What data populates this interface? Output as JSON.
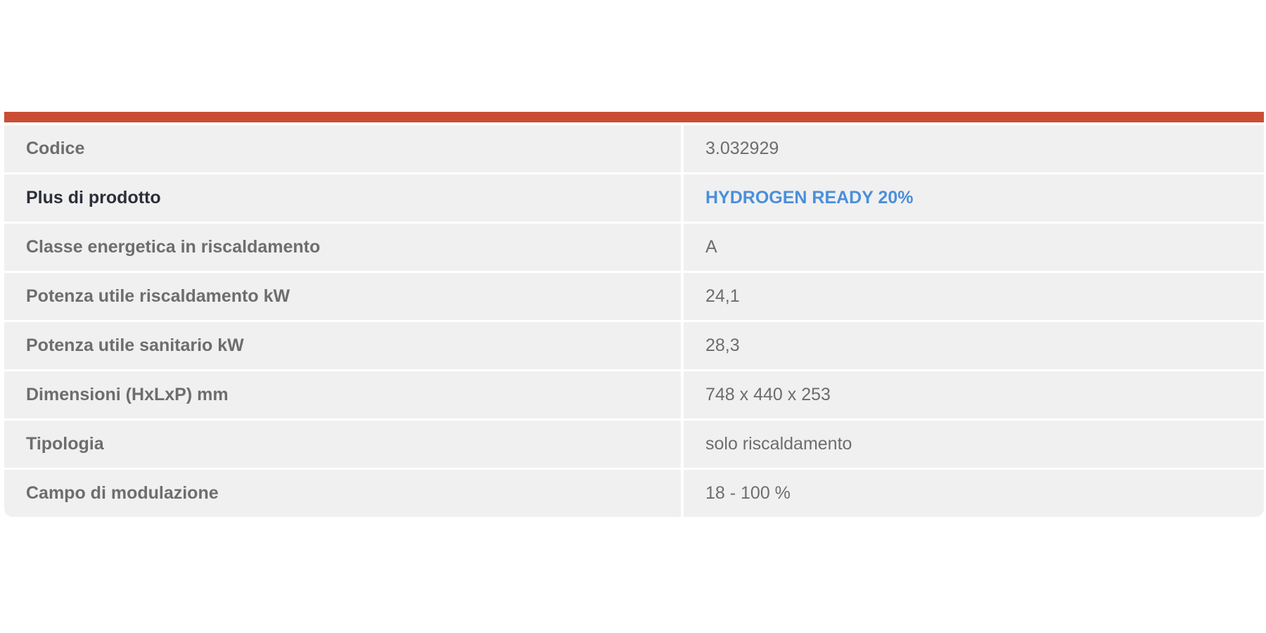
{
  "colors": {
    "accent": "#c94e35",
    "highlight": "#4a8fdb",
    "label_emphasis": "#2b2f3a"
  },
  "specs": [
    {
      "label": "Codice",
      "value": "3.032929"
    },
    {
      "label": "Plus di prodotto",
      "value": "HYDROGEN READY 20%"
    },
    {
      "label": "Classe energetica in riscaldamento",
      "value": "A"
    },
    {
      "label": "Potenza utile riscaldamento kW",
      "value": "24,1"
    },
    {
      "label": "Potenza utile sanitario kW",
      "value": "28,3"
    },
    {
      "label": "Dimensioni (HxLxP) mm",
      "value": "748 x 440 x 253"
    },
    {
      "label": "Tipologia",
      "value": "solo riscaldamento"
    },
    {
      "label": "Campo di modulazione",
      "value": "18 - 100 %"
    }
  ]
}
